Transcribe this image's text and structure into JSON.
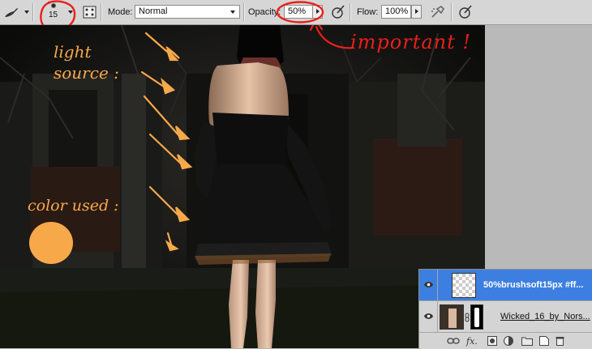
{
  "options_bar": {
    "brush_size": "15",
    "mode_label": "Mode:",
    "mode_value": "Normal",
    "opacity_label": "Opacity:",
    "opacity_value": "50%",
    "flow_label": "Flow:",
    "flow_value": "100%"
  },
  "annotations": {
    "important": "important !",
    "light_source": "light\nsource :",
    "color_used": "color used :",
    "swatch_color": "#f7a94a",
    "ink_color": "#e8201a"
  },
  "layers": [
    {
      "name": "50%brushsoft15px #ff...",
      "selected": true,
      "visible": true
    },
    {
      "name": "Wicked_16_by_Nors...",
      "selected": false,
      "visible": true
    }
  ],
  "layers_footer_icons": [
    "link-icon",
    "fx-icon",
    "mask-icon",
    "adjustment-icon",
    "group-icon",
    "new-layer-icon",
    "trash-icon"
  ],
  "colors": {
    "selected_row": "#3d7fe0",
    "panel_bg": "#d4d4d4"
  }
}
